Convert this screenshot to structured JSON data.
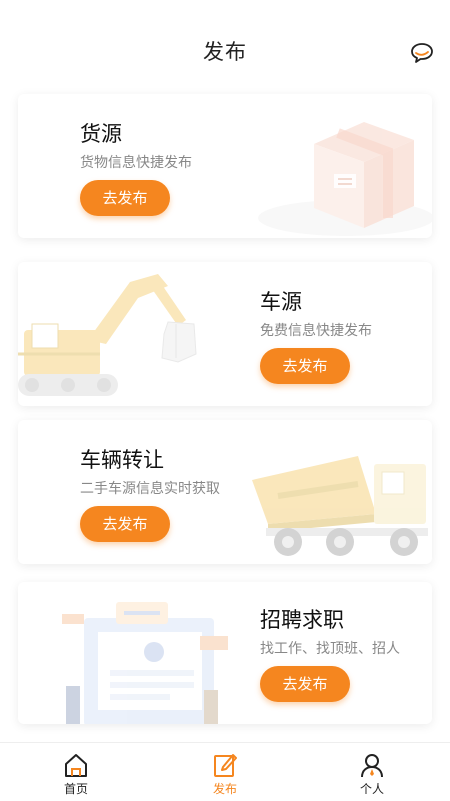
{
  "header": {
    "title": "发布",
    "chat_icon": "chat-bubble-icon"
  },
  "cards": [
    {
      "title": "货源",
      "subtitle": "货物信息快捷发布",
      "button": "去发布",
      "illustration": "cargo-box-icon"
    },
    {
      "title": "车源",
      "subtitle": "免费信息快捷发布",
      "button": "去发布",
      "illustration": "excavator-icon"
    },
    {
      "title": "车辆转让",
      "subtitle": "二手车源信息实时获取",
      "button": "去发布",
      "illustration": "dump-truck-icon"
    },
    {
      "title": "招聘求职",
      "subtitle": "找工作、找顶班、招人",
      "button": "去发布",
      "illustration": "job-board-icon"
    }
  ],
  "tabbar": {
    "items": [
      {
        "label": "首页",
        "icon": "home-icon",
        "active": false
      },
      {
        "label": "发布",
        "icon": "edit-icon",
        "active": true
      },
      {
        "label": "个人",
        "icon": "user-icon",
        "active": false
      }
    ]
  },
  "colors": {
    "accent": "#f5861f",
    "text": "#222222",
    "subtext": "#888888"
  }
}
